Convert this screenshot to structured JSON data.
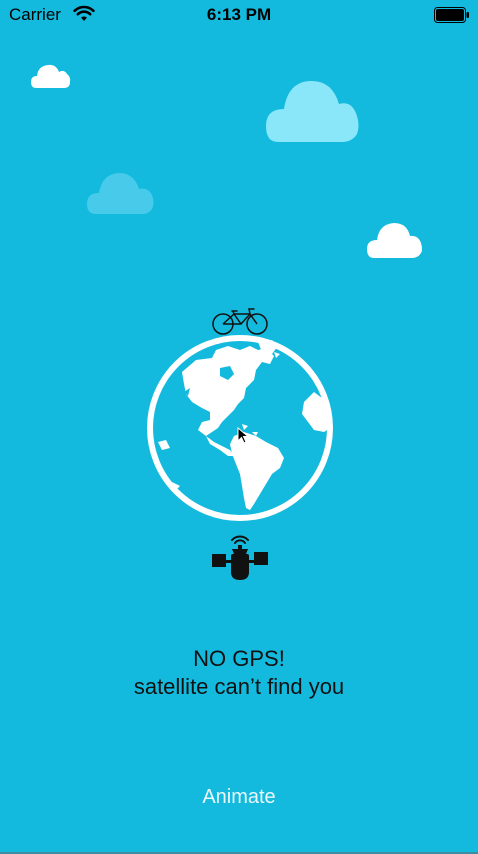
{
  "status_bar": {
    "carrier": "Carrier",
    "time": "6:13 PM"
  },
  "illustration": {
    "icons": [
      "bicycle-icon",
      "globe-icon",
      "satellite-icon"
    ],
    "colors": {
      "background": "#14BADD",
      "cloud_white": "#FFFFFF",
      "cloud_light": "#8AE7FA",
      "cloud_faint": "#48CBEB",
      "globe": "#FFFFFF",
      "ink": "#111111"
    }
  },
  "message": {
    "line1": "NO GPS!",
    "line2": "satellite can’t find you"
  },
  "actions": {
    "animate_label": "Animate"
  }
}
